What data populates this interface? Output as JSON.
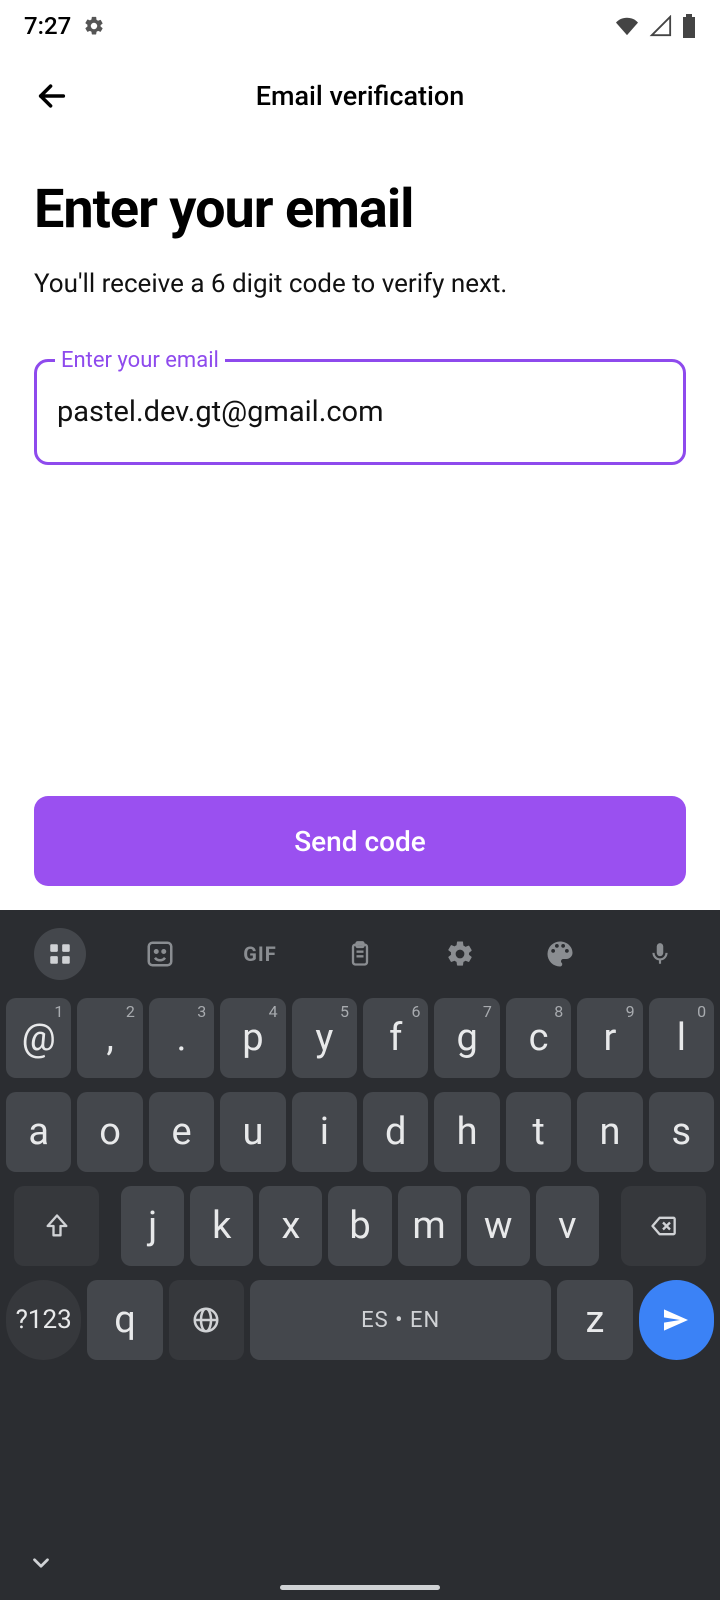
{
  "status": {
    "time": "7:27"
  },
  "header": {
    "title": "Email verification"
  },
  "main": {
    "title": "Enter your email",
    "subtitle": "You'll receive a 6 digit code to verify next.",
    "field_label": "Enter your email",
    "email_value": "pastel.dev.gt@gmail.com",
    "send_label": "Send code"
  },
  "keyboard": {
    "toolbar": [
      "apps-icon",
      "sticker-icon",
      "GIF",
      "clipboard-icon",
      "gear-icon",
      "palette-icon",
      "mic-icon"
    ],
    "row1": [
      {
        "k": "@",
        "s": "1"
      },
      {
        "k": ",",
        "s": "2"
      },
      {
        "k": ".",
        "s": "3"
      },
      {
        "k": "p",
        "s": "4"
      },
      {
        "k": "y",
        "s": "5"
      },
      {
        "k": "f",
        "s": "6"
      },
      {
        "k": "g",
        "s": "7"
      },
      {
        "k": "c",
        "s": "8"
      },
      {
        "k": "r",
        "s": "9"
      },
      {
        "k": "l",
        "s": "0"
      }
    ],
    "row2": [
      "a",
      "o",
      "e",
      "u",
      "i",
      "d",
      "h",
      "t",
      "n",
      "s"
    ],
    "row3": [
      "j",
      "k",
      "x",
      "b",
      "m",
      "w",
      "v"
    ],
    "fn_label": "?123",
    "row4_q": "q",
    "row4_z": "z",
    "space_label": "ES • EN"
  }
}
